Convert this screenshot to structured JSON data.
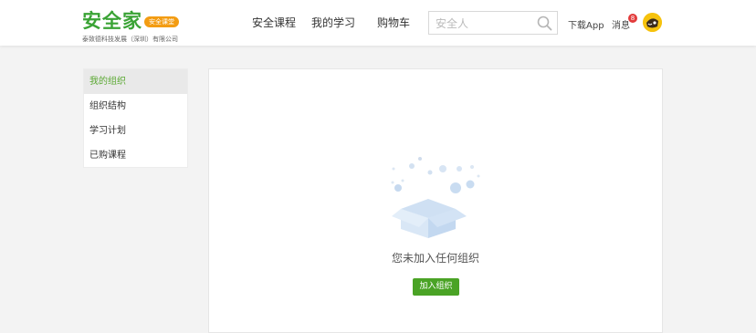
{
  "header": {
    "logo_text": "安全家",
    "logo_tag": "安全课堂",
    "company": "泰致德科技发展（深圳）有限公司",
    "nav": [
      {
        "label": "安全课程"
      },
      {
        "label": "我的学习"
      },
      {
        "label": "购物车"
      }
    ],
    "search": {
      "placeholder": "安全人"
    },
    "download_label": "下载App",
    "messages_label": "消息",
    "messages_count": "8"
  },
  "sidebar": {
    "items": [
      {
        "label": "我的组织",
        "active": true
      },
      {
        "label": "组织结构"
      },
      {
        "label": "学习计划"
      },
      {
        "label": "已购课程"
      }
    ]
  },
  "main": {
    "empty_text": "您未加入任何组织",
    "join_button": "加入组织"
  },
  "colors": {
    "brand": "#3aa335",
    "active_menu": "#5aa832",
    "button": "#4aa325",
    "badge": "#e23b3b",
    "logo_tag": "#f39c12"
  }
}
